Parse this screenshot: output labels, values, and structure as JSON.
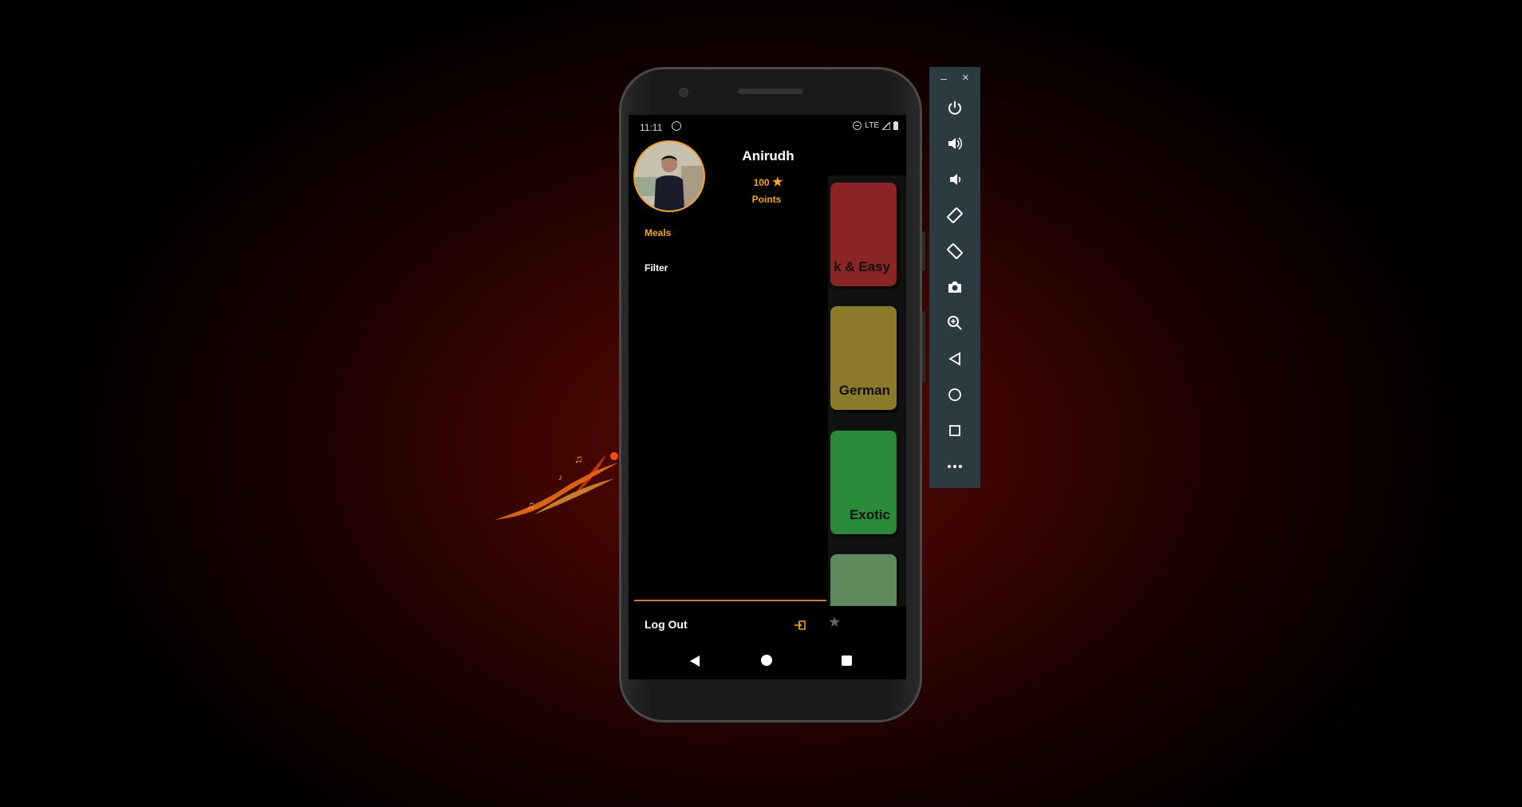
{
  "status_bar": {
    "time": "11:11",
    "network": "LTE"
  },
  "drawer": {
    "user_name": "Anirudh",
    "points_value": "100",
    "points_star": "★",
    "points_label": "Points",
    "menu": [
      {
        "label": "Meals",
        "active": true,
        "color": "#f5a623"
      },
      {
        "label": "Filter",
        "active": false,
        "color": "#ffffff"
      }
    ],
    "logout_label": "Log Out"
  },
  "categories": [
    {
      "label": "k & Easy",
      "color": "#8b2525"
    },
    {
      "label": "German",
      "color": "#8a7a2a"
    },
    {
      "label": "Exotic",
      "color": "#2a8a3a"
    },
    {
      "label": "",
      "color": "#5e8a5e"
    }
  ],
  "emulator_panel": {
    "minimize": "–",
    "close": "×",
    "buttons": [
      "power-icon",
      "volume-up-icon",
      "volume-down-icon",
      "rotate-left-icon",
      "rotate-right-icon",
      "camera-icon",
      "zoom-icon",
      "back-icon",
      "home-icon",
      "overview-icon",
      "more-icon"
    ]
  },
  "colors": {
    "accent": "#f5a623",
    "panel": "#2c3a42"
  }
}
